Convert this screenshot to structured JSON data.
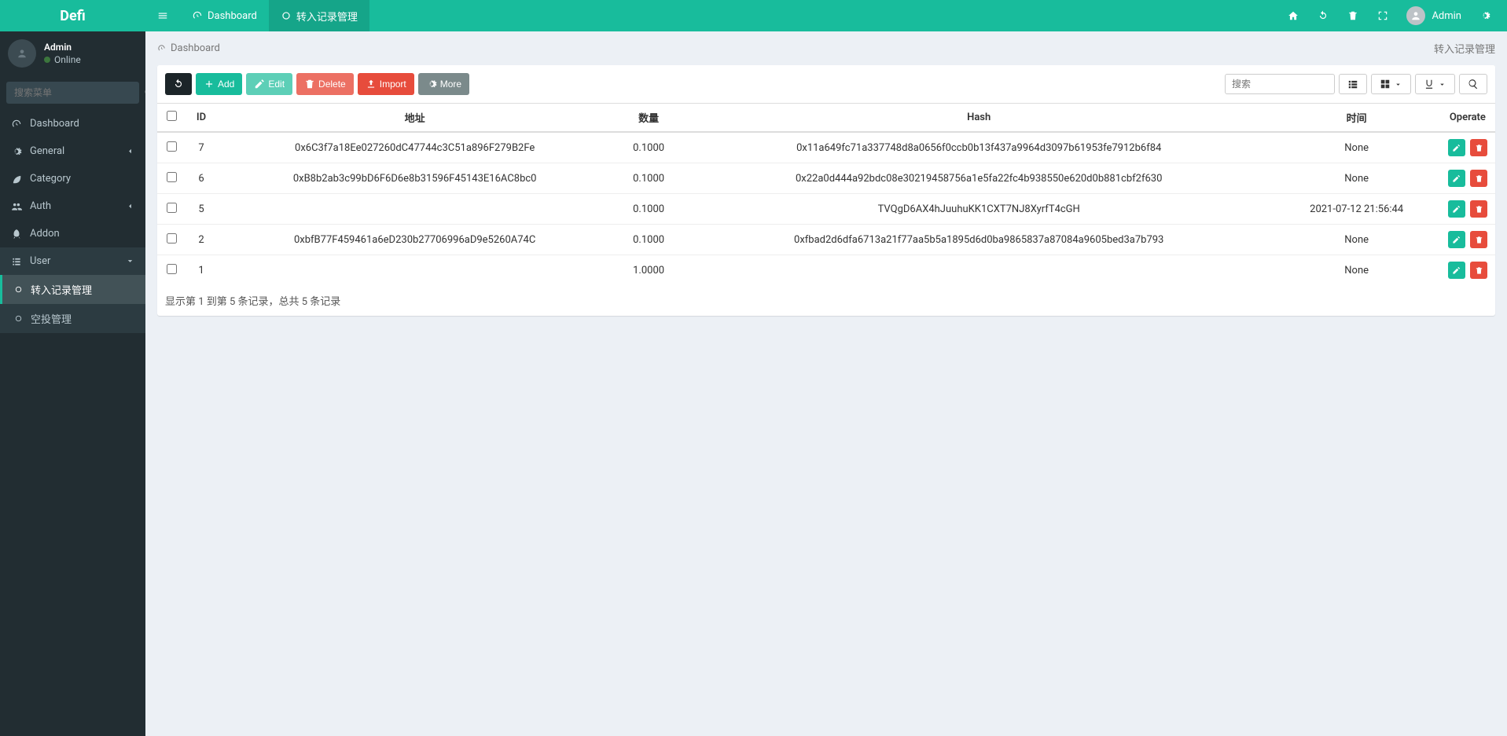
{
  "brand": "Defi",
  "header": {
    "tabs": [
      {
        "icon": "dashboard",
        "label": "Dashboard",
        "active": false
      },
      {
        "icon": "circle",
        "label": "转入记录管理",
        "active": true
      }
    ],
    "user": "Admin"
  },
  "sidebar": {
    "user": {
      "name": "Admin",
      "status": "Online"
    },
    "searchPlaceholder": "搜索菜单",
    "items": [
      {
        "icon": "dashboard",
        "label": "Dashboard"
      },
      {
        "icon": "cogs",
        "label": "General",
        "caret": true
      },
      {
        "icon": "leaf",
        "label": "Category"
      },
      {
        "icon": "group",
        "label": "Auth",
        "caret": true
      },
      {
        "icon": "rocket",
        "label": "Addon"
      },
      {
        "icon": "list",
        "label": "User",
        "caret": true,
        "open": true
      }
    ],
    "submenu": [
      {
        "icon": "circle",
        "label": "转入记录管理",
        "active": true
      },
      {
        "icon": "circle",
        "label": "空投管理",
        "active": false
      }
    ]
  },
  "breadcrumb": {
    "left": "Dashboard",
    "right": "转入记录管理"
  },
  "toolbar": {
    "refresh": "",
    "add": "Add",
    "edit": "Edit",
    "delete": "Delete",
    "import": "Import",
    "more": "More",
    "searchPlaceholder": "搜索"
  },
  "table": {
    "columns": {
      "id": "ID",
      "addr": "地址",
      "amount": "数量",
      "hash": "Hash",
      "time": "时间",
      "operate": "Operate"
    },
    "rows": [
      {
        "id": "7",
        "addr": "0x6C3f7a18Ee027260dC47744c3C51a896F279B2Fe",
        "amount": "0.1000",
        "hash": "0x11a649fc71a337748d8a0656f0ccb0b13f437a9964d3097b61953fe7912b6f84",
        "time": "None"
      },
      {
        "id": "6",
        "addr": "0xB8b2ab3c99bD6F6D6e8b31596F45143E16AC8bc0",
        "amount": "0.1000",
        "hash": "0x22a0d444a92bdc08e30219458756a1e5fa22fc4b938550e620d0b881cbf2f630",
        "time": "None"
      },
      {
        "id": "5",
        "addr": "",
        "amount": "0.1000",
        "hash": "TVQgD6AX4hJuuhuKK1CXT7NJ8XyrfT4cGH",
        "time": "2021-07-12 21:56:44"
      },
      {
        "id": "2",
        "addr": "0xbfB77F459461a6eD230b27706996aD9e5260A74C",
        "amount": "0.1000",
        "hash": "0xfbad2d6dfa6713a21f77aa5b5a1895d6d0ba9865837a87084a9605bed3a7b793",
        "time": "None"
      },
      {
        "id": "1",
        "addr": "",
        "amount": "1.0000",
        "hash": "",
        "time": "None"
      }
    ],
    "footer": "显示第 1 到第 5 条记录，总共 5 条记录"
  }
}
